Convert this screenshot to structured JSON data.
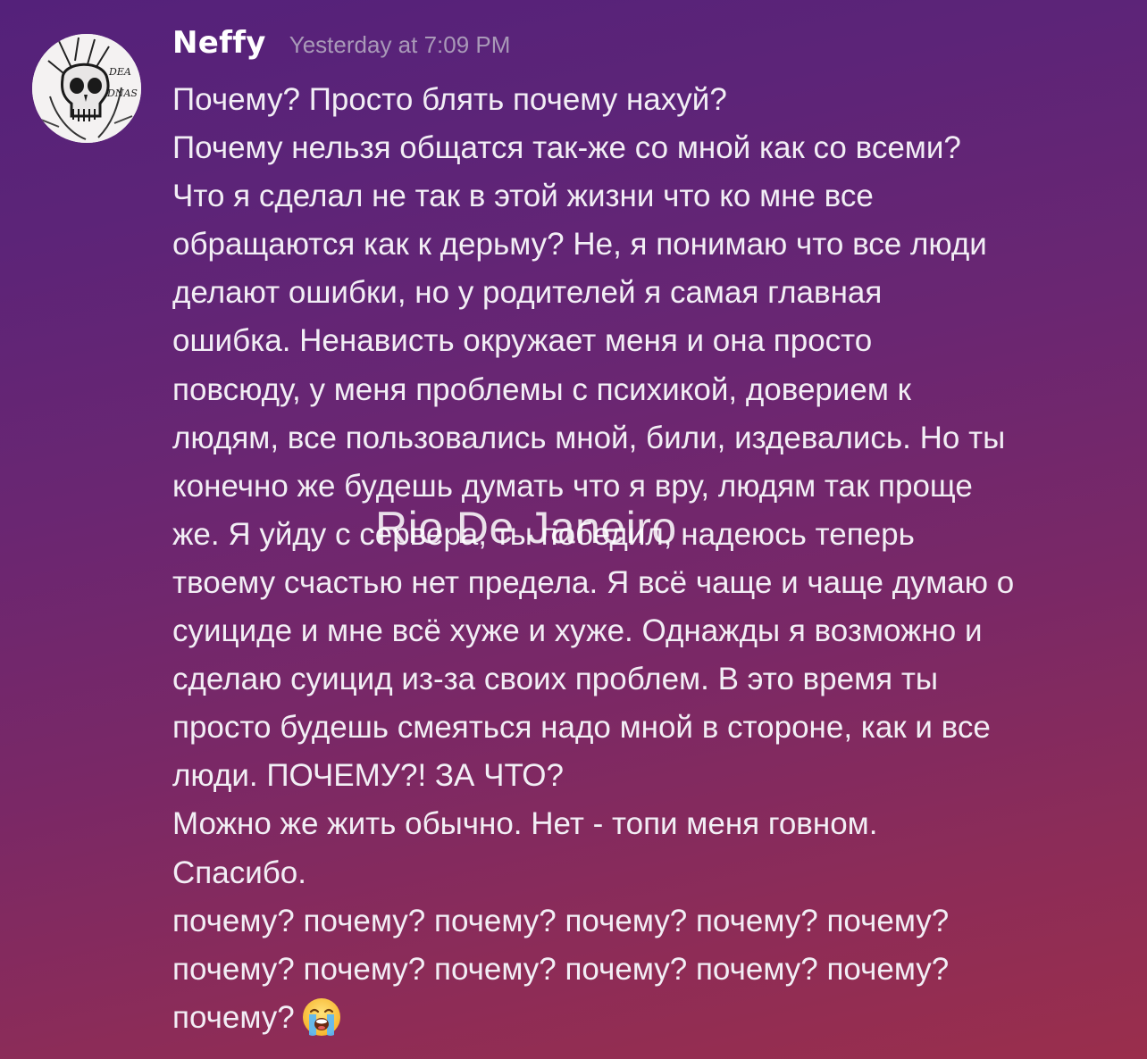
{
  "message": {
    "author": "Neffy",
    "timestamp": "Yesterday at 7:09 PM",
    "avatar_icon": "skull-avatar",
    "lines": [
      "Почему? Просто блять почему нахуй?",
      "Почему нельзя общатся так-же со мной как со всеми?",
      "Что я сделал не так в этой жизни что ко мне все",
      "обращаются как к дерьму? Не, я понимаю что все люди",
      "делают ошибки, но у родителей я самая главная",
      "ошибка. Ненависть окружает меня и она просто",
      "повсюду, у меня проблемы с психикой, доверием к",
      "людям, все пользовались мной, били, издевались. Но ты",
      "конечно же будешь думать что я вру, людям так проще",
      "же. Я уйду с сервера, ты победил, надеюсь теперь",
      "твоему счастью нет предела. Я всё чаще и чаще думаю о",
      "суициде и мне всё хуже и хуже. Однажды я возможно и",
      "сделаю суицид из-за своих проблем. В это время ты",
      "просто будешь смеяться надо мной в стороне, как и все",
      "люди. ПОЧЕМУ?! ЗА ЧТО?",
      "Можно же жить обычно. Нет - топи меня говном.",
      "Спасибо.",
      "почему? почему? почему? почему? почему? почему?",
      "почему? почему? почему? почему? почему? почему?",
      "почему?"
    ],
    "trailing_emoji": "loudly-crying-face-emoji"
  },
  "watermark": "Rio De Janeiro",
  "colors": {
    "background_top": "#54217a",
    "background_bottom": "#9a2e4c",
    "text": "#f2eef5",
    "timestamp": "#a999b8"
  }
}
